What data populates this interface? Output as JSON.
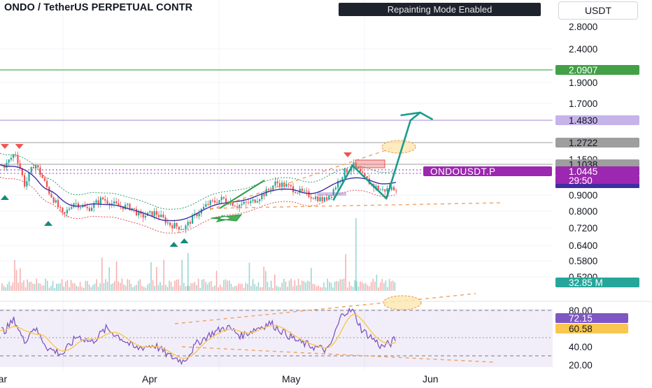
{
  "header": {
    "title": "ONDO / TetherUS PERPETUAL CONTR",
    "notice": "Repainting Mode Enabled",
    "currency": "USDT"
  },
  "colors": {
    "up": "#26a69a",
    "down": "#ef5350",
    "green_line": "#4caf50",
    "purple_line": "#b39ddb",
    "ma_blue": "#3f2ea3",
    "rsi": "#7e57c2",
    "rsi_ma": "#f9c74f",
    "orange_dash": "#f0a060",
    "arrow": "#1a9c8c",
    "price_tag": "#9c27b0"
  },
  "chart_data": [
    {
      "type": "line",
      "panel": "price",
      "symbol_label": "ONDOUSDT.P",
      "scale": "log",
      "y_ticks": [
        "2.8000",
        "2.4000",
        "1.9000",
        "1.7000",
        "1.1500",
        "0.9000",
        "0.8000",
        "0.7200",
        "0.6400",
        "0.5800",
        "0.5200"
      ],
      "x_ticks": [
        "Mar",
        "Apr",
        "May",
        "Jun"
      ],
      "price_labels": [
        {
          "value": "2.0907",
          "kind": "green_line"
        },
        {
          "value": "1.4830",
          "kind": "purple_line"
        },
        {
          "value": "1.2722",
          "kind": "gray_line"
        },
        {
          "value": "1.1038",
          "kind": "gray_line"
        },
        {
          "value": "1.0445",
          "kind": "last_price"
        },
        {
          "value": "29:50",
          "kind": "countdown"
        },
        {
          "value": "32.85 M",
          "kind": "volume"
        }
      ],
      "price_series": [
        [
          "2025-03-01",
          1.1
        ],
        [
          "2025-03-03",
          1.2
        ],
        [
          "2025-03-05",
          0.96
        ],
        [
          "2025-03-07",
          1.12
        ],
        [
          "2025-03-10",
          0.92
        ],
        [
          "2025-03-13",
          0.78
        ],
        [
          "2025-03-15",
          0.86
        ],
        [
          "2025-03-18",
          0.82
        ],
        [
          "2025-03-21",
          0.88
        ],
        [
          "2025-03-24",
          0.84
        ],
        [
          "2025-03-27",
          0.83
        ],
        [
          "2025-03-29",
          0.78
        ],
        [
          "2025-04-01",
          0.8
        ],
        [
          "2025-04-04",
          0.74
        ],
        [
          "2025-04-07",
          0.72
        ],
        [
          "2025-04-09",
          0.78
        ],
        [
          "2025-04-12",
          0.85
        ],
        [
          "2025-04-15",
          0.88
        ],
        [
          "2025-04-18",
          0.84
        ],
        [
          "2025-04-21",
          0.86
        ],
        [
          "2025-04-24",
          0.92
        ],
        [
          "2025-04-26",
          0.98
        ],
        [
          "2025-04-28",
          0.96
        ],
        [
          "2025-05-01",
          0.92
        ],
        [
          "2025-05-04",
          0.89
        ],
        [
          "2025-05-06",
          0.87
        ],
        [
          "2025-05-08",
          0.94
        ],
        [
          "2025-05-10",
          1.05
        ],
        [
          "2025-05-12",
          1.1
        ],
        [
          "2025-05-14",
          1.02
        ],
        [
          "2025-05-16",
          0.96
        ],
        [
          "2025-05-18",
          0.93
        ],
        [
          "2025-05-21",
          0.95
        ],
        [
          "2025-05-23",
          1.04
        ]
      ],
      "projection": [
        [
          "2025-05-08",
          0.87
        ],
        [
          "2025-05-12",
          1.1
        ],
        [
          "2025-05-19",
          0.88
        ],
        [
          "2025-05-24",
          1.49
        ],
        [
          "2025-05-26",
          1.57
        ]
      ],
      "markers": [
        {
          "date": "2025-03-01",
          "type": "sell"
        },
        {
          "date": "2025-03-04",
          "type": "sell"
        },
        {
          "date": "2025-03-01",
          "type": "buy"
        },
        {
          "date": "2025-03-10",
          "type": "buy"
        },
        {
          "date": "2025-04-05",
          "type": "buy"
        },
        {
          "date": "2025-04-06",
          "type": "buy"
        },
        {
          "date": "2025-05-11",
          "type": "sell"
        }
      ]
    },
    {
      "type": "line",
      "panel": "rsi",
      "y_ticks": [
        "80.00",
        "40.00",
        "20.00"
      ],
      "levels": {
        "upper": 80,
        "middle": 50,
        "lower": 30
      },
      "rsi_value": "72.15",
      "rsi_ma_value": "60.58",
      "rsi_series": [
        [
          "2025-03-01",
          58
        ],
        [
          "2025-03-03",
          70
        ],
        [
          "2025-03-05",
          45
        ],
        [
          "2025-03-07",
          62
        ],
        [
          "2025-03-10",
          38
        ],
        [
          "2025-03-13",
          32
        ],
        [
          "2025-03-16",
          52
        ],
        [
          "2025-03-19",
          45
        ],
        [
          "2025-03-22",
          60
        ],
        [
          "2025-03-25",
          50
        ],
        [
          "2025-03-28",
          38
        ],
        [
          "2025-04-01",
          42
        ],
        [
          "2025-04-04",
          30
        ],
        [
          "2025-04-07",
          24
        ],
        [
          "2025-04-10",
          45
        ],
        [
          "2025-04-13",
          55
        ],
        [
          "2025-04-16",
          62
        ],
        [
          "2025-04-19",
          52
        ],
        [
          "2025-04-22",
          60
        ],
        [
          "2025-04-25",
          66
        ],
        [
          "2025-04-28",
          55
        ],
        [
          "2025-05-01",
          45
        ],
        [
          "2025-05-04",
          40
        ],
        [
          "2025-05-07",
          36
        ],
        [
          "2025-05-10",
          78
        ],
        [
          "2025-05-12",
          80
        ],
        [
          "2025-05-14",
          58
        ],
        [
          "2025-05-16",
          50
        ],
        [
          "2025-05-18",
          40
        ],
        [
          "2025-05-20",
          44
        ],
        [
          "2025-05-22",
          55
        ],
        [
          "2025-05-23",
          72
        ]
      ]
    }
  ]
}
